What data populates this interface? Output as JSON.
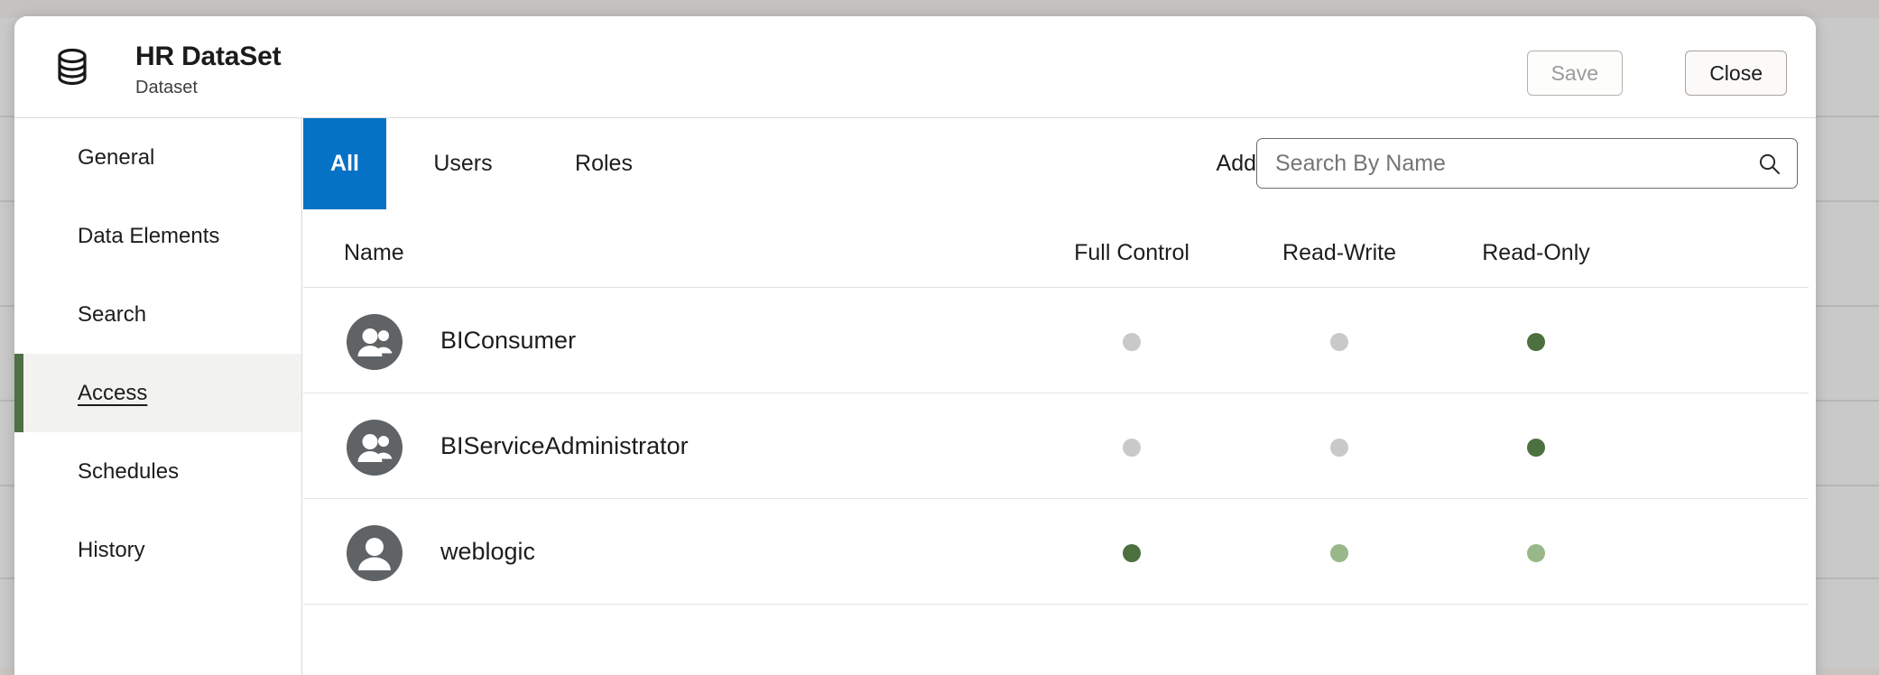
{
  "backdrop": {
    "row_count": 7
  },
  "header": {
    "icon": "database-icon",
    "title": "HR DataSet",
    "subtitle": "Dataset",
    "save_label": "Save",
    "close_label": "Close",
    "save_disabled": true
  },
  "sidebar": {
    "items": [
      {
        "label": "General",
        "active": false
      },
      {
        "label": "Data Elements",
        "active": false
      },
      {
        "label": "Search",
        "active": false
      },
      {
        "label": "Access",
        "active": true
      },
      {
        "label": "Schedules",
        "active": false
      },
      {
        "label": "History",
        "active": false
      }
    ],
    "active_accent": "#4f6f45"
  },
  "main": {
    "tabs": [
      {
        "label": "All",
        "active": true
      },
      {
        "label": "Users",
        "active": false
      },
      {
        "label": "Roles",
        "active": false
      }
    ],
    "active_tab_color": "#0572c6",
    "add_label": "Add",
    "search": {
      "value": "",
      "placeholder": "Search By Name",
      "icon": "search-icon"
    },
    "table": {
      "columns": [
        "Name",
        "Full Control",
        "Read-Write",
        "Read-Only"
      ],
      "column_x": {
        "full_control": 918,
        "read_write": 1148,
        "read_only": 1366
      },
      "rows": [
        {
          "name": "BIConsumer",
          "avatar": "group-icon",
          "full_control": "off",
          "read_write": "off",
          "read_only": "on"
        },
        {
          "name": "BIServiceAdministrator",
          "avatar": "group-icon",
          "full_control": "off",
          "read_write": "off",
          "read_only": "on"
        },
        {
          "name": "weblogic",
          "avatar": "user-icon",
          "full_control": "on",
          "read_write": "implied",
          "read_only": "implied"
        }
      ],
      "state_colors": {
        "off": "#c9c9c9",
        "on": "#4d7040",
        "implied": "#99b88a"
      }
    }
  }
}
